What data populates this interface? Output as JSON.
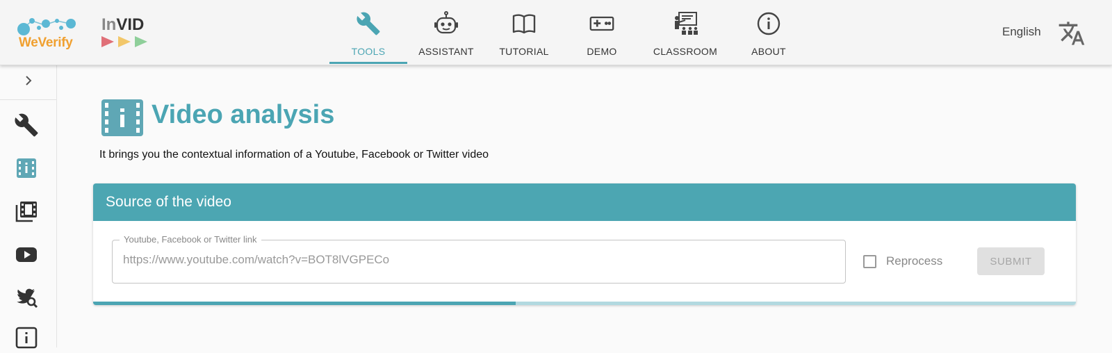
{
  "brand": {
    "weverify": "WeVerify",
    "invid_in": "In",
    "invid_vid": "VID"
  },
  "nav": {
    "items": [
      {
        "label": "TOOLS",
        "icon": "wrench-icon",
        "active": true
      },
      {
        "label": "ASSISTANT",
        "icon": "robot-icon",
        "active": false
      },
      {
        "label": "TUTORIAL",
        "icon": "book-icon",
        "active": false
      },
      {
        "label": "DEMO",
        "icon": "gamepad-icon",
        "active": false
      },
      {
        "label": "CLASSROOM",
        "icon": "classroom-icon",
        "active": false
      },
      {
        "label": "ABOUT",
        "icon": "info-icon",
        "active": false
      }
    ]
  },
  "language": {
    "label": "English",
    "icon": "translate-icon"
  },
  "sidebar": {
    "items": [
      {
        "icon": "wrench-icon",
        "active": false
      },
      {
        "icon": "video-analysis-icon",
        "active": true
      },
      {
        "icon": "film-stack-icon",
        "active": false
      },
      {
        "icon": "youtube-icon",
        "active": false
      },
      {
        "icon": "twitter-search-icon",
        "active": false
      },
      {
        "icon": "info-box-icon",
        "active": false
      }
    ]
  },
  "page": {
    "title": "Video analysis",
    "subtitle": "It brings you the contextual information of a Youtube, Facebook or Twitter video"
  },
  "source_card": {
    "header": "Source of the video",
    "field_label": "Youtube, Facebook or Twitter link",
    "field_value": "https://www.youtube.com/watch?v=BOT8lVGPECo",
    "reprocess_label": "Reprocess",
    "reprocess_checked": false,
    "submit_label": "SUBMIT",
    "progress_fraction": 0.43
  },
  "colors": {
    "accent": "#4ba5b3",
    "brand_orange": "#f0a030",
    "brand_blue": "#5bb8d4"
  }
}
